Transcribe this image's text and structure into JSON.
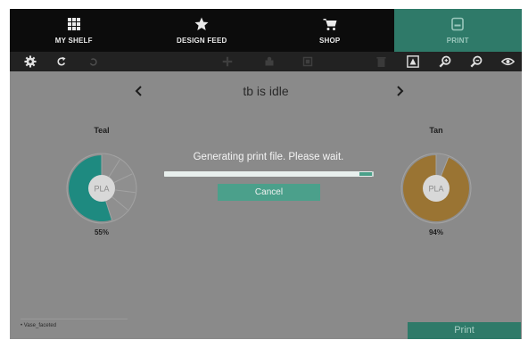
{
  "nav": {
    "items": [
      {
        "label": "MY SHELF",
        "icon": "grid-icon"
      },
      {
        "label": "DESIGN FEED",
        "icon": "star-icon"
      },
      {
        "label": "SHOP",
        "icon": "cart-icon"
      },
      {
        "label": "PRINT",
        "icon": "printer-icon"
      }
    ]
  },
  "toolbar": {
    "icons": [
      "gear-icon",
      "undo-icon",
      "redo-icon",
      "move-icon",
      "rotate-icon",
      "scale-icon",
      "trash-icon",
      "layout-icon",
      "zoom-in-icon",
      "zoom-out-icon",
      "eye-icon"
    ]
  },
  "status": {
    "text": "tb is idle"
  },
  "spools": [
    {
      "name": "Teal",
      "material": "PLA",
      "percent": "55%",
      "fill_fraction": 0.55,
      "color": "#1e8a80"
    },
    {
      "name": "Tan",
      "material": "PLA",
      "percent": "94%",
      "fill_fraction": 0.94,
      "color": "#9a7433"
    }
  ],
  "modal": {
    "message": "Generating print file. Please wait.",
    "progress_fraction": 0.99,
    "cancel_label": "Cancel"
  },
  "file_list": {
    "items": [
      "Vase_faceted"
    ]
  },
  "print_button": {
    "label": "Print"
  },
  "colors": {
    "accent": "#2f7a69",
    "button": "#4ba08b",
    "overlay": "#8a8a8a"
  }
}
